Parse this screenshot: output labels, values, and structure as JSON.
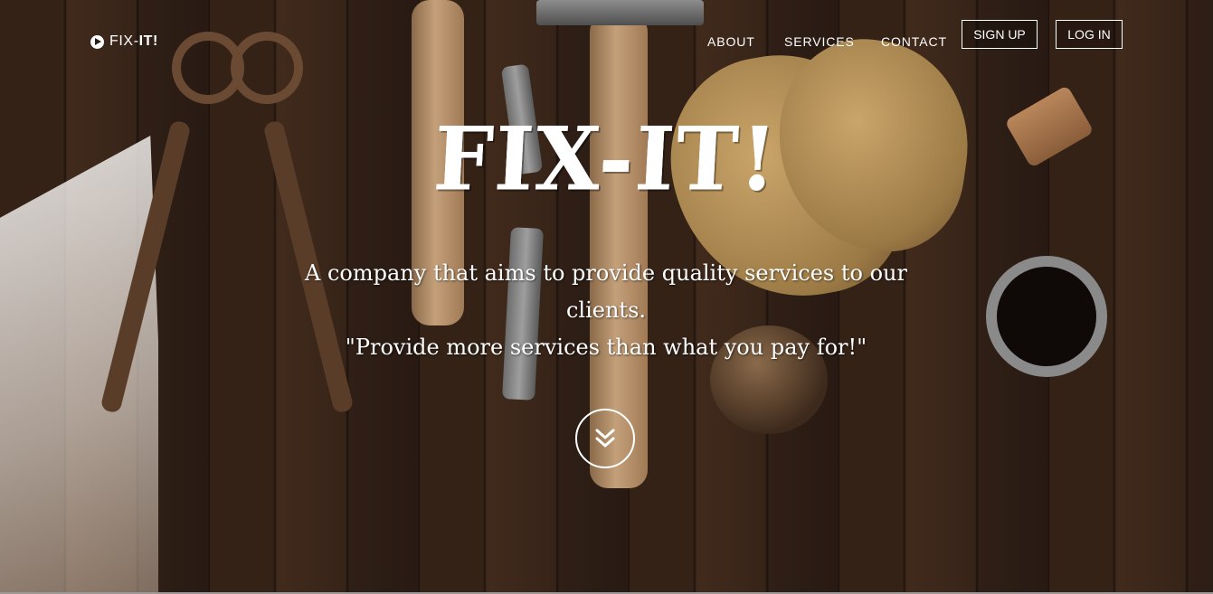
{
  "brand": {
    "logo_text_a": "FIX-",
    "logo_text_b": "IT!",
    "logo_icon": "play-circle-icon"
  },
  "nav": {
    "about": "ABOUT",
    "services": "SERVICES",
    "contact": "CONTACT",
    "signup": "SIGN UP",
    "login": "LOG IN"
  },
  "hero": {
    "headline": "FIX-IT!",
    "tagline_line1": "A company that aims to provide quality services to our clients.",
    "tagline_line2": "\"Provide more services than what you pay for!\"",
    "scroll_icon": "double-chevron-down-icon"
  },
  "colors": {
    "text": "#ffffff",
    "background_wood": "#3b271a"
  }
}
